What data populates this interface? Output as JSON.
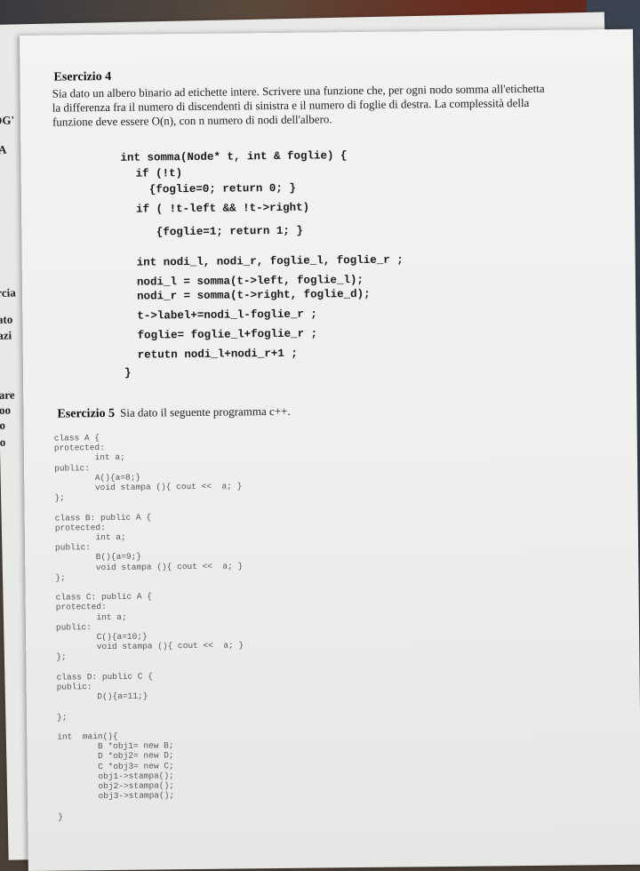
{
  "background": {
    "left_edge_fragments": [
      "OG'",
      "IA",
      "rcia",
      "ato",
      "azi",
      "are",
      "oo",
      "o",
      "o"
    ]
  },
  "exercise4": {
    "title": "Esercizio 4",
    "text_lines": [
      "Sia dato un albero binario ad etichette intere. Scrivere una funzione che, per ogni nodo somma all'etichetta",
      "la differenza fra il numero di discendenti di sinistra e il numero di foglie di destra. La complessità della",
      "funzione deve essere O(n), con n numero di nodi dell'albero."
    ],
    "code_lines": [
      "int somma(Node* t, int & foglie) {",
      "  if (!t)",
      "    {foglie=0; return 0; }",
      "  if ( !t-left && !t->right)",
      "     {foglie=1; return 1; }",
      "",
      "  int nodi_l, nodi_r, foglie_l, foglie_r ;",
      "  nodi_l = somma(t->left, foglie_l);",
      "  nodi_r = somma(t->right, foglie_d);",
      "  t->label+=nodi_l-foglie_r ;",
      "  foglie= foglie_l+foglie_r ;",
      "  retutn nodi_l+nodi_r+1 ;",
      "}"
    ]
  },
  "exercise5": {
    "title": "Esercizio 5",
    "intro": "Sia dato il seguente programma c++.",
    "code_lines": [
      "class A {",
      "protected:",
      "        int a;",
      "public:",
      "        A(){a=8;}",
      "        void stampa (){ cout <<  a; }",
      "};",
      "",
      "class B: public A {",
      "protected:",
      "        int a;",
      "public:",
      "        B(){a=9;}",
      "        void stampa (){ cout <<  a; }",
      "};",
      "",
      "class C: public A {",
      "protected:",
      "        int a;",
      "public:",
      "        C(){a=10;}",
      "        void stampa (){ cout <<  a; }",
      "};",
      "",
      "class D: public C {",
      "public:",
      "        D(){a=11;}",
      "",
      "};",
      "",
      "int  main(){",
      "        B *obj1= new B;",
      "        D *obj2= new D;",
      "        C *obj3= new C;",
      "        obj1->stampa();",
      "        obj2->stampa();",
      "        obj3->stampa();",
      "",
      "}"
    ]
  }
}
